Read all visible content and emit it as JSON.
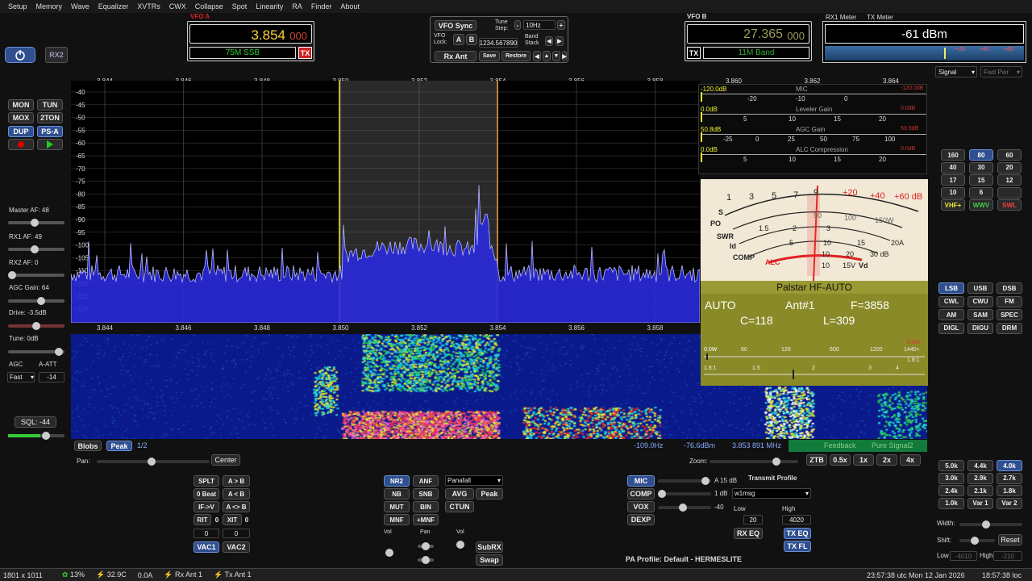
{
  "menu": [
    "Setup",
    "Memory",
    "Wave",
    "Equalizer",
    "XVTRs",
    "CWX",
    "Collapse",
    "Spot",
    "Linearity",
    "RA",
    "Finder",
    "About"
  ],
  "vfoA": {
    "label": "VFO A",
    "freq": "3.854",
    "freq_sub": "000",
    "band": "75M SSB",
    "tx": "TX"
  },
  "vfoB": {
    "label": "VFO B",
    "freq": "27.365",
    "freq_sub": "000",
    "band": "11M Band",
    "tx": "TX"
  },
  "vfo_controls": {
    "sync": "VFO Sync",
    "lock": "VFO Lock:",
    "a": "A",
    "b": "B",
    "tune_step_label": "Tune Step:",
    "tune_step": "10Hz",
    "freq_entry": "1234.567890",
    "band_stack": "Band Stack",
    "rx_ant": "Rx Ant",
    "save": "Save",
    "restore": "Restore"
  },
  "meters": {
    "rx1": "RX1 Meter",
    "tx": "TX Meter",
    "reading": "-61 dBm",
    "scale_a": "+20",
    "scale_b": "+40",
    "scale_c": "+60",
    "signal": "Signal",
    "fwd_pwr": "Fwd Pwr"
  },
  "left": {
    "rx2": "RX2",
    "buttons": [
      "MON",
      "TUN",
      "MOX",
      "2TON",
      "DUP",
      "PS-A"
    ],
    "master_af": "Master AF:  48",
    "rx1_af": "RX1 AF:  49",
    "rx2_af": "RX2 AF:  0",
    "agc_gain": "AGC Gain:  64",
    "drive": "Drive:  -3.5dB",
    "tune": "Tune:  0dB",
    "agc": "AGC",
    "a_att": "A-ATT",
    "agc_mode": "Fast",
    "att_val": "-14",
    "sql": "SQL: -44"
  },
  "freq_axis": [
    "3.844",
    "3.846",
    "3.848",
    "3.850",
    "3.852",
    "3.854",
    "3.856",
    "3.858",
    "3.860",
    "3.862",
    "3.864"
  ],
  "db_axis": [
    "-40",
    "-45",
    "-50",
    "-55",
    "-60",
    "-65",
    "-70",
    "-75",
    "-80",
    "-85",
    "-90",
    "-95",
    "-100",
    "-105",
    "-110",
    "-115",
    "-120",
    "-125"
  ],
  "tx_meters": [
    {
      "val": "-120.0dB",
      "name": "MIC",
      "ticks": [
        "-20",
        "-10",
        "0"
      ],
      "r": "-120.0dB"
    },
    {
      "val": "0.0dB",
      "name": "Leveler Gain",
      "ticks": [
        "5",
        "10",
        "15",
        "20"
      ],
      "r": "0.0dB"
    },
    {
      "val": "50.8dB",
      "name": "AGC Gain",
      "ticks": [
        "-25",
        "0",
        "25",
        "50",
        "75",
        "100"
      ],
      "r": "53.9dB"
    },
    {
      "val": "0.0dB",
      "name": "ALC Compression",
      "ticks": [
        "5",
        "10",
        "15",
        "20"
      ],
      "r": "0.0dB"
    }
  ],
  "analog_meter": {
    "s_scale": [
      "1",
      "3",
      "5",
      "7",
      "9",
      "+20",
      "+40",
      "+60 dB"
    ],
    "labels": [
      "S",
      "PO",
      "SWR",
      "Id",
      "COMP",
      "ALC",
      "Vd"
    ],
    "po_scale": [
      "50",
      "100",
      "150W"
    ],
    "swr_scale": [
      "1.5",
      "2",
      "3"
    ],
    "id_scale": [
      "5",
      "10",
      "15",
      "20A"
    ],
    "comp_scale": [
      "10",
      "20",
      "30 dB"
    ],
    "vd_scale": [
      "10",
      "15V"
    ]
  },
  "tuner": {
    "title": "Palstar  HF-AUTO",
    "mode": "AUTO",
    "ant": "Ant#1",
    "freq": "F=3858",
    "c": "C=118",
    "l": "L=309",
    "pwr_scale": [
      "0.0W",
      "60",
      "120",
      "600",
      "1200",
      "1440+"
    ],
    "pwr_max": "6.0W",
    "swr_scale": [
      "1.8:1",
      "1.5",
      "2",
      "3",
      "4",
      "1.8:1"
    ]
  },
  "bands": [
    "160",
    "80",
    "60",
    "40",
    "30",
    "20",
    "17",
    "15",
    "12",
    "10",
    "6",
    "",
    "VHF+",
    "WWV",
    "SWL"
  ],
  "modes": [
    "LSB",
    "USB",
    "DSB",
    "CWL",
    "CWU",
    "FM",
    "AM",
    "SAM",
    "SPEC",
    "DIGL",
    "DIGU",
    "DRM"
  ],
  "filters": [
    "5.0k",
    "4.4k",
    "4.0k",
    "3.0k",
    "2.9k",
    "2.7k",
    "2.4k",
    "2.1k",
    "1.8k",
    "1.0k",
    "Var 1",
    "Var 2"
  ],
  "pan_info": {
    "blobs": "Blobs",
    "peak": "Peak",
    "frac": "1/2",
    "offset": "-109.0Hz",
    "level": "-76.6dBm",
    "cursor": "3.853 891 MHz",
    "feedback": "Feedback",
    "ps": "Pure Signal2"
  },
  "bottom": {
    "pan": "Pan:",
    "center": "Center",
    "zoom": "Zoom:",
    "zoom_btns": [
      "ZTB",
      "0.5x",
      "1x",
      "2x",
      "4x"
    ],
    "split": [
      "SPLT",
      "A > B",
      "0 Beat",
      "A < B",
      "IF->V",
      "A <> B",
      "RIT",
      "0",
      "XIT",
      "0"
    ],
    "rit_val": "0",
    "xit_val": "0",
    "vac1": "VAC1",
    "vac2": "VAC2",
    "dsp": [
      "NR2",
      "ANF",
      "NB",
      "SNB",
      "MUT",
      "BIN",
      "MNF",
      "+MNF"
    ],
    "panafall": "Panafall",
    "avg": "AVG",
    "peak": "Peak",
    "ctun": "CTUN",
    "vol": "Vol",
    "pan2": "Pan",
    "vol2": "Vol",
    "subrx": "SubRX",
    "swap": "Swap",
    "tx_btns": [
      "MIC",
      "COMP",
      "VOX",
      "DEXP"
    ],
    "a15db": "A 15 dB",
    "db1": "1 dB",
    "m40": "-40",
    "tx_profile": "Transmit Profile",
    "profile": "w1msg",
    "low": "Low",
    "high": "High",
    "low_val": "20",
    "high_val": "4020",
    "rx_eq": "RX EQ",
    "tx_eq": "TX EQ",
    "tx_fl": "TX FL",
    "pa_profile": "PA Profile: Default - HERMESLITE",
    "width": "Width:",
    "shift": "Shift:",
    "reset": "Reset",
    "flow": "Low",
    "fhigh": "High",
    "flow_val": "-4010",
    "fhigh_val": "-210"
  },
  "status": {
    "res": "1801 x 1011",
    "cpu": "13%",
    "temp": "32.9C",
    "cur": "0.0A",
    "rx_ant": "Rx Ant 1",
    "tx_ant": "Tx Ant 1",
    "utc": "23:57:38 utc  Mon 12 Jan 2026",
    "loc": "18:57:38 loc"
  }
}
